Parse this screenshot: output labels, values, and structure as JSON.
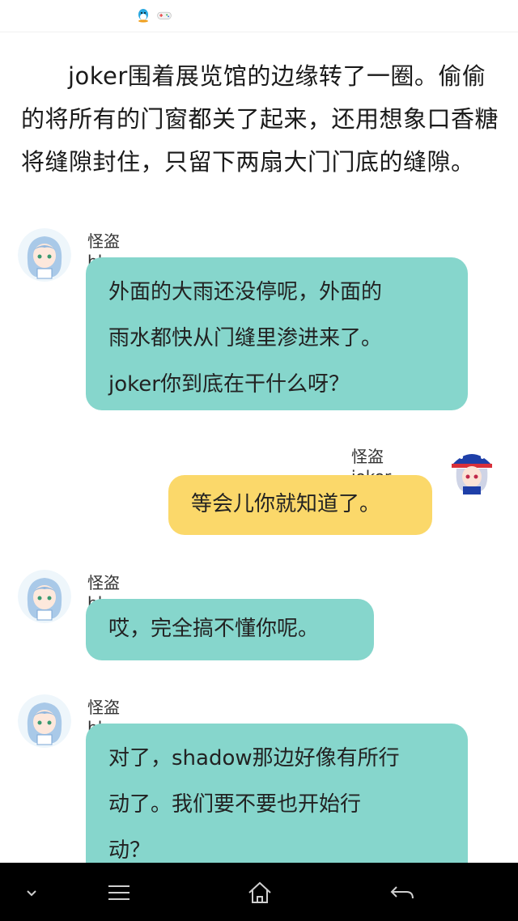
{
  "narration": "joker围着展览馆的边缘转了一圈。偷偷的将所有的门窗都关了起来，还用想象口香糖将缝隙封住，只留下两扇大门门底的缝隙。",
  "messages": [
    {
      "sender": "怪盗blue",
      "side": "left",
      "color": "#86d6cc",
      "lines": [
        "外面的大雨还没停呢，外面的",
        "雨水都快从门缝里渗进来了。",
        "joker你到底在干什么呀？"
      ]
    },
    {
      "sender": "怪盗joker",
      "side": "right",
      "color": "#fbd86a",
      "lines": [
        "等会儿你就知道了。"
      ]
    },
    {
      "sender": "怪盗blue",
      "side": "left",
      "color": "#86d6cc",
      "lines": [
        "哎，完全搞不懂你呢。"
      ]
    },
    {
      "sender": "怪盗blue",
      "side": "left",
      "color": "#86d6cc",
      "lines": [
        "对了，shadow那边好像有所行",
        "动了。我们要不要也开始行",
        "动？"
      ]
    }
  ],
  "status_icons": [
    "qq-penguin-icon",
    "gamepad-icon"
  ],
  "nav_icons": [
    "chevron-down-icon",
    "menu-icon",
    "home-icon",
    "back-icon"
  ]
}
